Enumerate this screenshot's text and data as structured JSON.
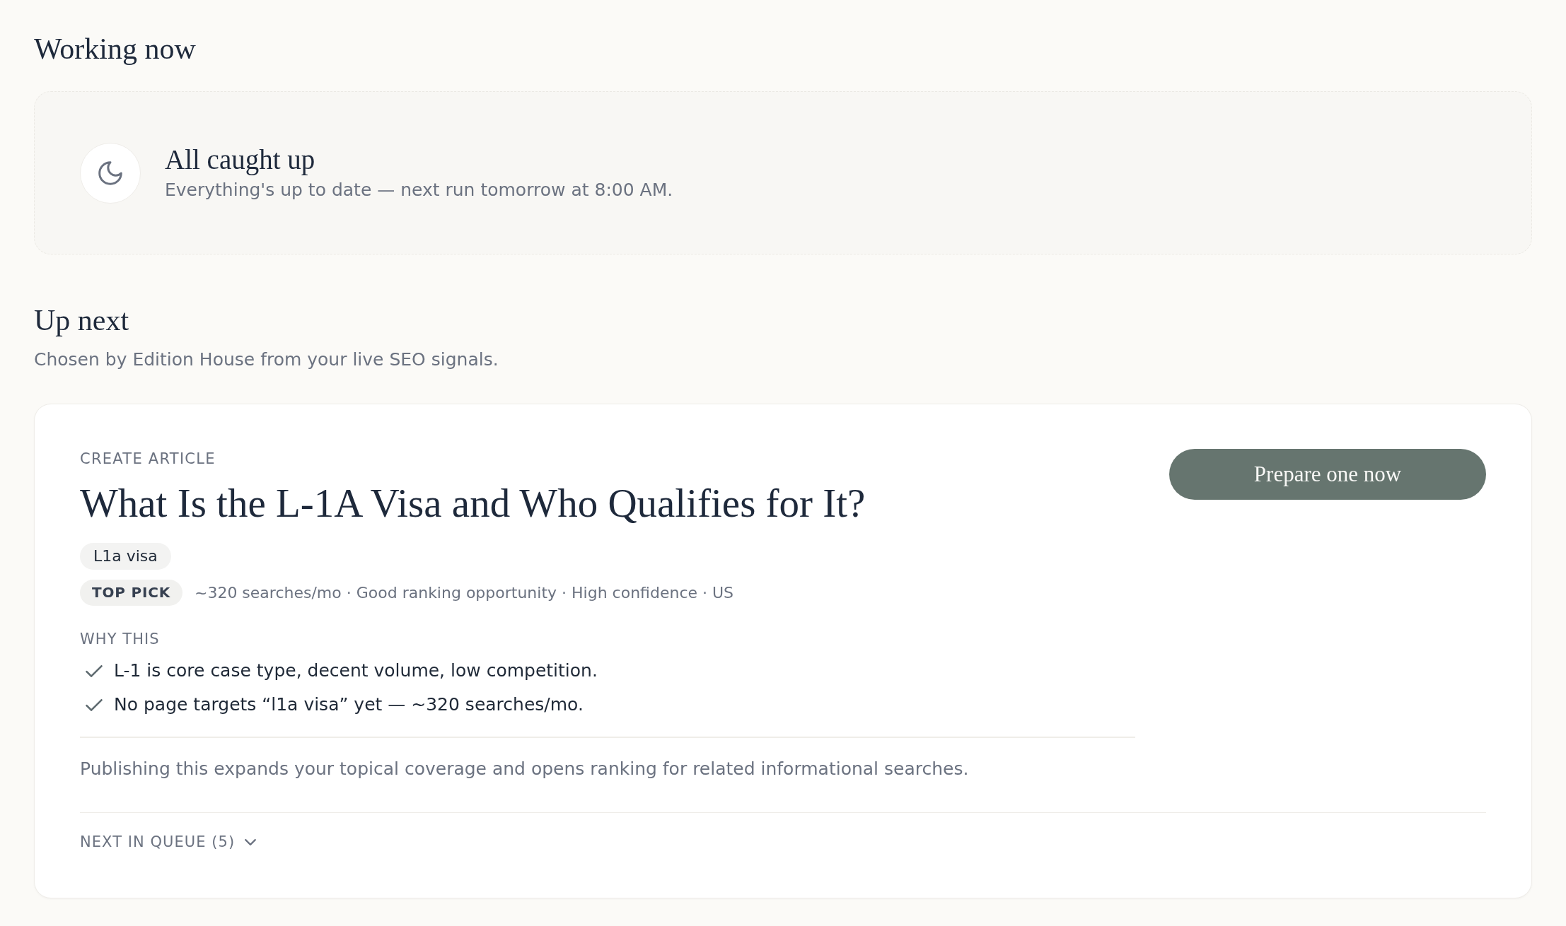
{
  "working_now": {
    "title": "Working now",
    "status": {
      "title": "All caught up",
      "message": "Everything's up to date — next run tomorrow at 8:00 AM."
    }
  },
  "up_next": {
    "title": "Up next",
    "subtitle": "Chosen by Edition House from your live SEO signals.",
    "card": {
      "category": "CREATE ARTICLE",
      "title": "What Is the L-1A Visa and Who Qualifies for It?",
      "tags": [
        "L1a visa"
      ],
      "badge": "TOP PICK",
      "meta": "~320 searches/mo · Good ranking opportunity · High confidence · US",
      "why_heading": "WHY THIS",
      "reasons": [
        "L-1 is core case type, decent volume, low competition.",
        "No page targets “l1a visa” yet — ~320 searches/mo."
      ],
      "impact": "Publishing this expands your topical coverage and opens ranking for related informational searches.",
      "action_button": "Prepare one now",
      "queue": {
        "label": "NEXT IN QUEUE (5)",
        "expanded": false
      }
    }
  }
}
